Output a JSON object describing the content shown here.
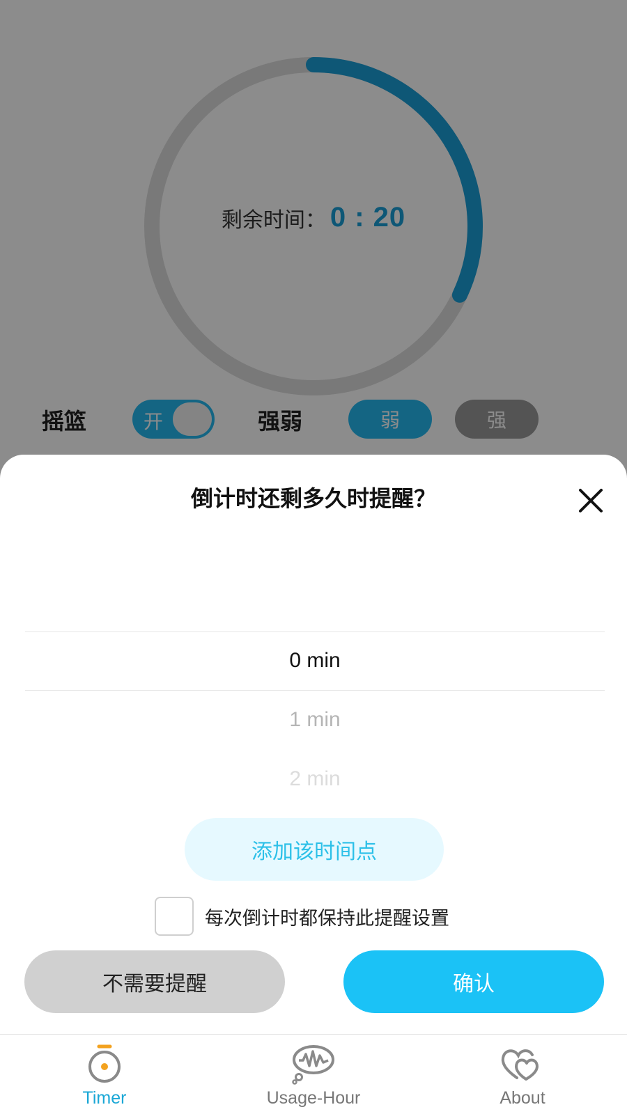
{
  "timer": {
    "remaining_label": "剩余时间：",
    "remaining_time": "0 : 20",
    "progress_fraction": 0.32,
    "cradle_label": "摇篮",
    "cradle_toggle_text": "开",
    "intensity_label": "强弱",
    "intensity_weak": "弱",
    "intensity_strong": "强"
  },
  "reminder_sheet": {
    "title": "倒计时还剩多久时提醒？",
    "picker_items": [
      "0 min",
      "1 min",
      "2 min"
    ],
    "selected_item": "0 min",
    "add_button_label": "添加该时间点",
    "keep_setting_label": "每次倒计时都保持此提醒设置",
    "keep_setting_checked": false,
    "no_reminder_label": "不需要提醒",
    "confirm_label": "确认"
  },
  "tabs": [
    {
      "label": "Timer",
      "icon": "stopwatch-icon",
      "active": true
    },
    {
      "label": "Usage-Hour",
      "icon": "waveform-icon",
      "active": false
    },
    {
      "label": "About",
      "icon": "hearts-icon",
      "active": false
    }
  ],
  "colors": {
    "accent": "#1bc2f6",
    "progress": "#1a9ed8",
    "active_tab": "#1aa7d6",
    "inactive_tab": "#777777",
    "timer_dot": "#f3a21f"
  }
}
